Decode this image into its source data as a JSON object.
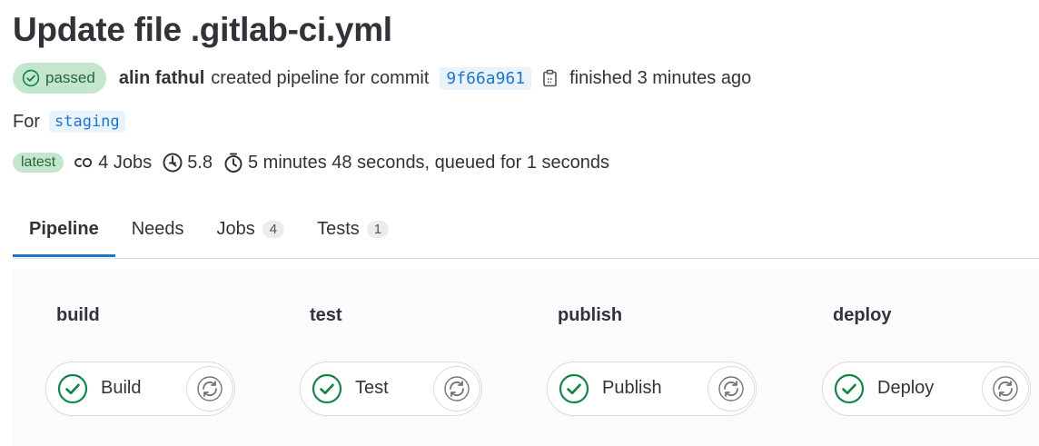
{
  "title": "Update file .gitlab-ci.yml",
  "pipeline": {
    "status_label": "passed",
    "author": "alin fathul",
    "created_text": "created pipeline for commit",
    "commit_sha": "9f66a961",
    "finished_text": "finished 3 minutes ago",
    "for_label": "For",
    "branch": "staging",
    "latest_label": "latest",
    "jobs_text": "4 Jobs",
    "compute_text": "5.8",
    "duration_text": "5 minutes 48 seconds, queued for 1 seconds"
  },
  "tabs": [
    {
      "label": "Pipeline",
      "count": null,
      "active": true
    },
    {
      "label": "Needs",
      "count": null,
      "active": false
    },
    {
      "label": "Jobs",
      "count": "4",
      "active": false
    },
    {
      "label": "Tests",
      "count": "1",
      "active": false
    }
  ],
  "stages": [
    {
      "title": "build",
      "job": "Build",
      "status": "success"
    },
    {
      "title": "test",
      "job": "Test",
      "status": "success"
    },
    {
      "title": "publish",
      "job": "Publish",
      "status": "success"
    },
    {
      "title": "deploy",
      "job": "Deploy",
      "status": "success"
    }
  ],
  "colors": {
    "success": "#108548",
    "link": "#1f75cb",
    "badge_bg": "#c3e6cd",
    "tab_indicator": "#1f75cb"
  },
  "icons": {
    "status": "status-success-icon",
    "copy": "copy-to-clipboard-icon",
    "jobs": "pipeline-jobs-icon",
    "compute": "compute-minutes-icon",
    "duration": "timer-icon",
    "retry": "retry-icon"
  }
}
